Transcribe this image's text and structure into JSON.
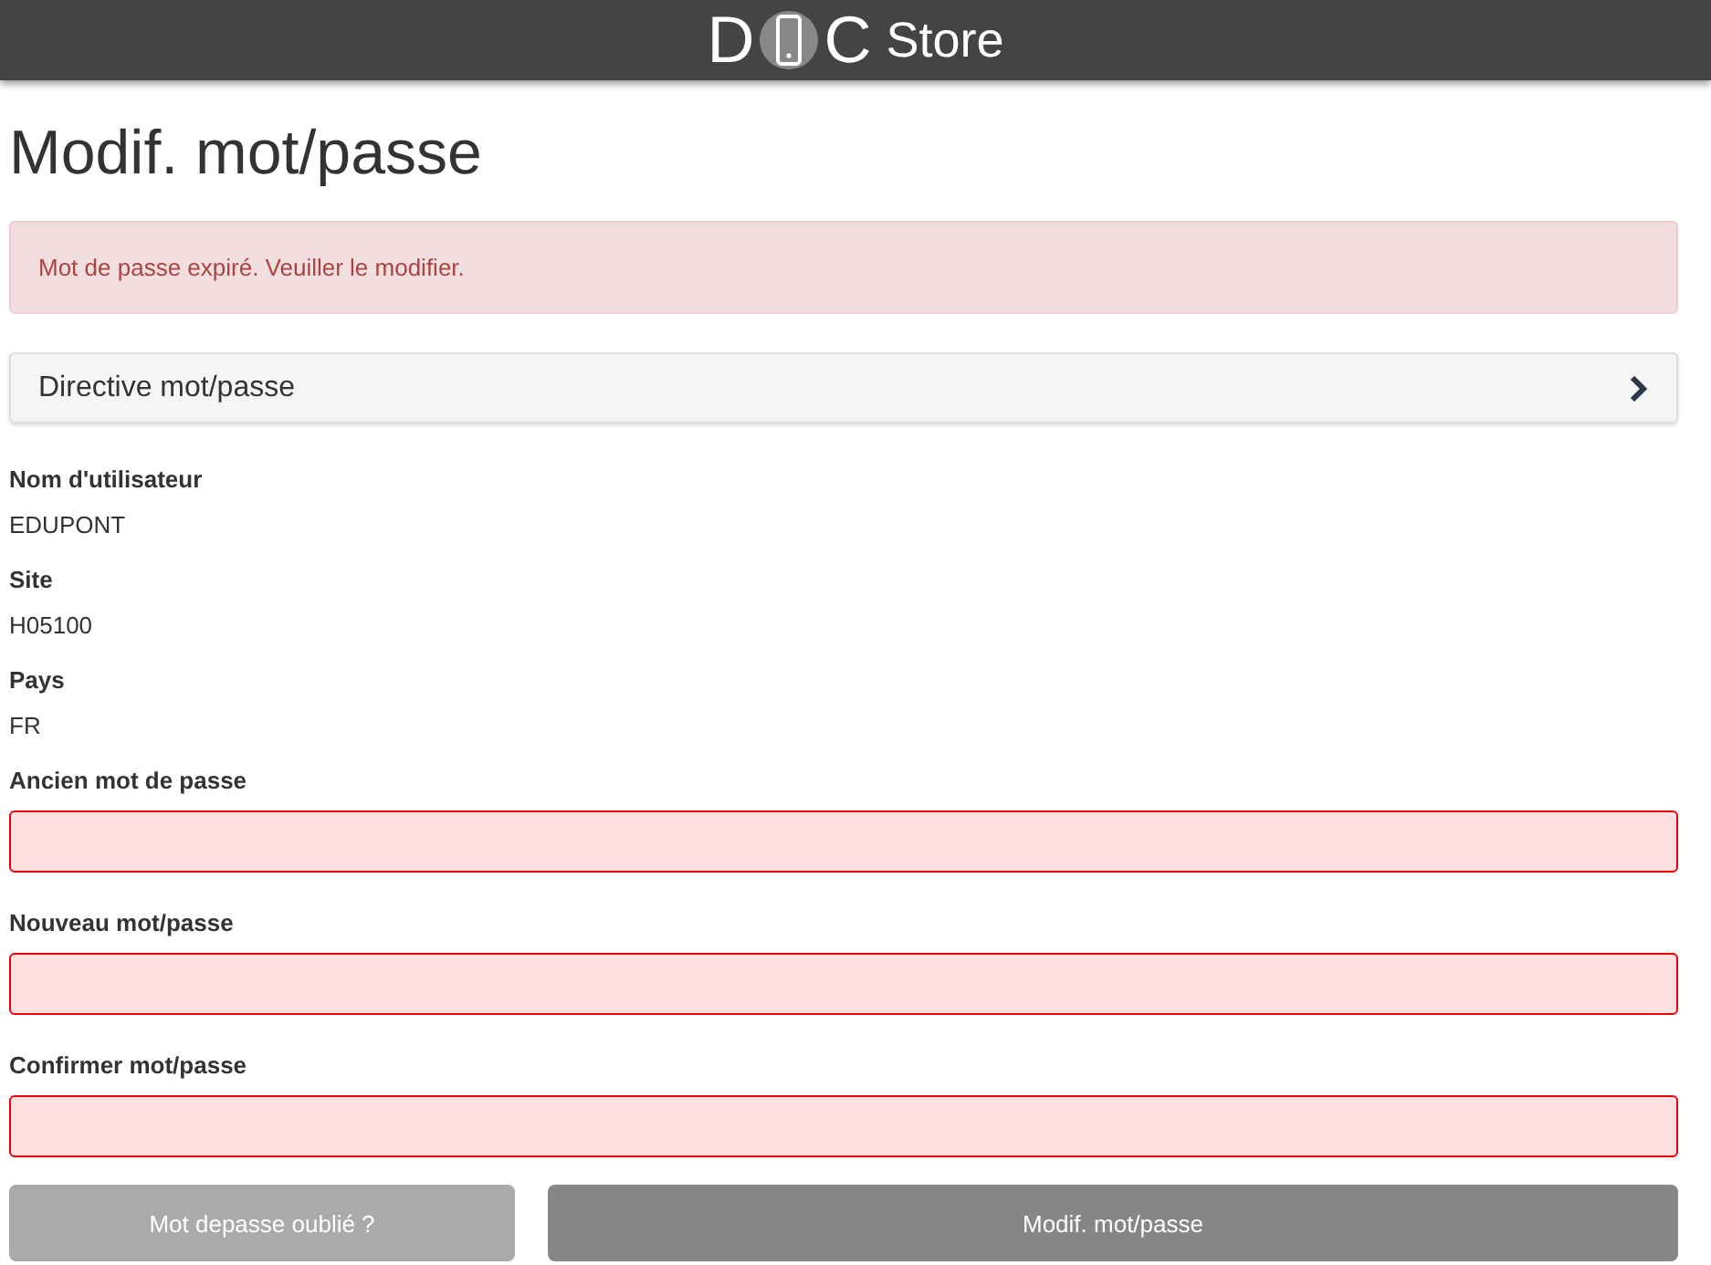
{
  "header": {
    "logo_left": "D",
    "logo_right": "C",
    "logo_word": "Store"
  },
  "title": "Modif. mot/passe",
  "alert": {
    "text": "Mot de passe expiré. Veuiller le modifier."
  },
  "panel": {
    "title": "Directive mot/passe",
    "expanded": false
  },
  "fields": [
    {
      "kind": "static",
      "label": "Nom d'utilisateur",
      "value": "EDUPONT"
    },
    {
      "kind": "static",
      "label": "Site",
      "value": "H05100"
    },
    {
      "kind": "static",
      "label": "Pays",
      "value": "FR"
    },
    {
      "kind": "input",
      "label": "Ancien mot de passe",
      "invalid": true
    },
    {
      "kind": "input",
      "label": "Nouveau mot/passe",
      "invalid": true
    },
    {
      "kind": "input",
      "label": "Confirmer mot/passe",
      "invalid": true
    }
  ],
  "buttons": [
    {
      "kind": "secondary",
      "label": "Mot depasse oublié ?"
    },
    {
      "kind": "primary",
      "label": "Modif. mot/passe"
    }
  ]
}
